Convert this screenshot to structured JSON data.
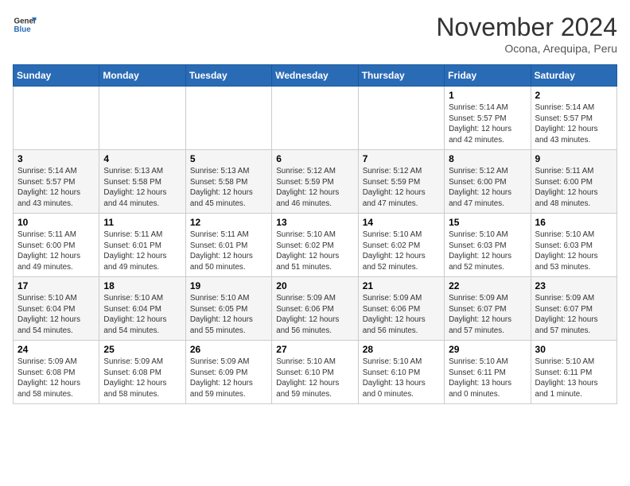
{
  "header": {
    "logo": {
      "general": "General",
      "blue": "Blue"
    },
    "title": "November 2024",
    "location": "Ocona, Arequipa, Peru"
  },
  "weekdays": [
    "Sunday",
    "Monday",
    "Tuesday",
    "Wednesday",
    "Thursday",
    "Friday",
    "Saturday"
  ],
  "weeks": [
    [
      {
        "day": null,
        "info": null
      },
      {
        "day": null,
        "info": null
      },
      {
        "day": null,
        "info": null
      },
      {
        "day": null,
        "info": null
      },
      {
        "day": null,
        "info": null
      },
      {
        "day": "1",
        "info": "Sunrise: 5:14 AM\nSunset: 5:57 PM\nDaylight: 12 hours\nand 42 minutes."
      },
      {
        "day": "2",
        "info": "Sunrise: 5:14 AM\nSunset: 5:57 PM\nDaylight: 12 hours\nand 43 minutes."
      }
    ],
    [
      {
        "day": "3",
        "info": "Sunrise: 5:14 AM\nSunset: 5:57 PM\nDaylight: 12 hours\nand 43 minutes."
      },
      {
        "day": "4",
        "info": "Sunrise: 5:13 AM\nSunset: 5:58 PM\nDaylight: 12 hours\nand 44 minutes."
      },
      {
        "day": "5",
        "info": "Sunrise: 5:13 AM\nSunset: 5:58 PM\nDaylight: 12 hours\nand 45 minutes."
      },
      {
        "day": "6",
        "info": "Sunrise: 5:12 AM\nSunset: 5:59 PM\nDaylight: 12 hours\nand 46 minutes."
      },
      {
        "day": "7",
        "info": "Sunrise: 5:12 AM\nSunset: 5:59 PM\nDaylight: 12 hours\nand 47 minutes."
      },
      {
        "day": "8",
        "info": "Sunrise: 5:12 AM\nSunset: 6:00 PM\nDaylight: 12 hours\nand 47 minutes."
      },
      {
        "day": "9",
        "info": "Sunrise: 5:11 AM\nSunset: 6:00 PM\nDaylight: 12 hours\nand 48 minutes."
      }
    ],
    [
      {
        "day": "10",
        "info": "Sunrise: 5:11 AM\nSunset: 6:00 PM\nDaylight: 12 hours\nand 49 minutes."
      },
      {
        "day": "11",
        "info": "Sunrise: 5:11 AM\nSunset: 6:01 PM\nDaylight: 12 hours\nand 49 minutes."
      },
      {
        "day": "12",
        "info": "Sunrise: 5:11 AM\nSunset: 6:01 PM\nDaylight: 12 hours\nand 50 minutes."
      },
      {
        "day": "13",
        "info": "Sunrise: 5:10 AM\nSunset: 6:02 PM\nDaylight: 12 hours\nand 51 minutes."
      },
      {
        "day": "14",
        "info": "Sunrise: 5:10 AM\nSunset: 6:02 PM\nDaylight: 12 hours\nand 52 minutes."
      },
      {
        "day": "15",
        "info": "Sunrise: 5:10 AM\nSunset: 6:03 PM\nDaylight: 12 hours\nand 52 minutes."
      },
      {
        "day": "16",
        "info": "Sunrise: 5:10 AM\nSunset: 6:03 PM\nDaylight: 12 hours\nand 53 minutes."
      }
    ],
    [
      {
        "day": "17",
        "info": "Sunrise: 5:10 AM\nSunset: 6:04 PM\nDaylight: 12 hours\nand 54 minutes."
      },
      {
        "day": "18",
        "info": "Sunrise: 5:10 AM\nSunset: 6:04 PM\nDaylight: 12 hours\nand 54 minutes."
      },
      {
        "day": "19",
        "info": "Sunrise: 5:10 AM\nSunset: 6:05 PM\nDaylight: 12 hours\nand 55 minutes."
      },
      {
        "day": "20",
        "info": "Sunrise: 5:09 AM\nSunset: 6:06 PM\nDaylight: 12 hours\nand 56 minutes."
      },
      {
        "day": "21",
        "info": "Sunrise: 5:09 AM\nSunset: 6:06 PM\nDaylight: 12 hours\nand 56 minutes."
      },
      {
        "day": "22",
        "info": "Sunrise: 5:09 AM\nSunset: 6:07 PM\nDaylight: 12 hours\nand 57 minutes."
      },
      {
        "day": "23",
        "info": "Sunrise: 5:09 AM\nSunset: 6:07 PM\nDaylight: 12 hours\nand 57 minutes."
      }
    ],
    [
      {
        "day": "24",
        "info": "Sunrise: 5:09 AM\nSunset: 6:08 PM\nDaylight: 12 hours\nand 58 minutes."
      },
      {
        "day": "25",
        "info": "Sunrise: 5:09 AM\nSunset: 6:08 PM\nDaylight: 12 hours\nand 58 minutes."
      },
      {
        "day": "26",
        "info": "Sunrise: 5:09 AM\nSunset: 6:09 PM\nDaylight: 12 hours\nand 59 minutes."
      },
      {
        "day": "27",
        "info": "Sunrise: 5:10 AM\nSunset: 6:10 PM\nDaylight: 12 hours\nand 59 minutes."
      },
      {
        "day": "28",
        "info": "Sunrise: 5:10 AM\nSunset: 6:10 PM\nDaylight: 13 hours\nand 0 minutes."
      },
      {
        "day": "29",
        "info": "Sunrise: 5:10 AM\nSunset: 6:11 PM\nDaylight: 13 hours\nand 0 minutes."
      },
      {
        "day": "30",
        "info": "Sunrise: 5:10 AM\nSunset: 6:11 PM\nDaylight: 13 hours\nand 1 minute."
      }
    ]
  ]
}
